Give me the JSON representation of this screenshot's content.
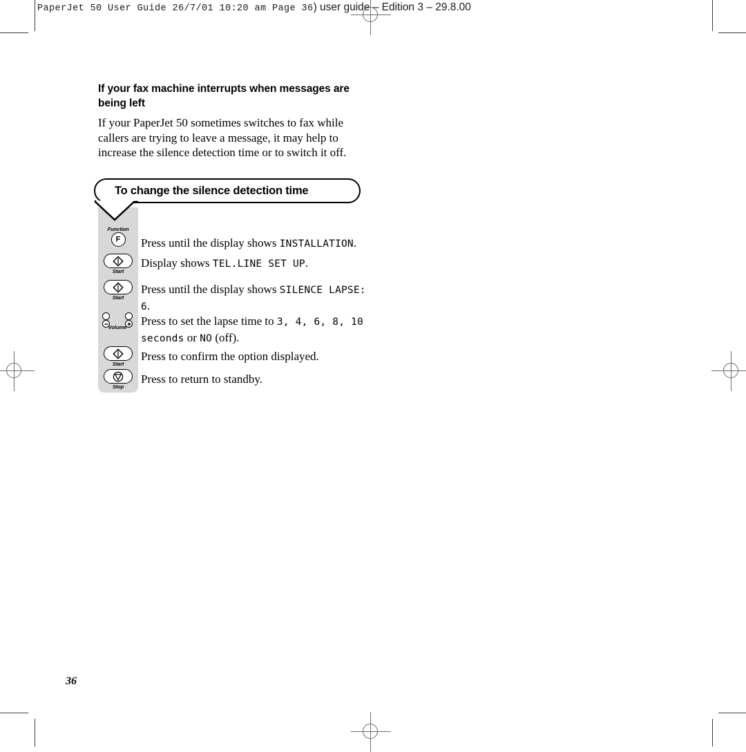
{
  "page": {
    "number": "36",
    "background": "#ffffff",
    "panel_color": "#d8d8d8"
  },
  "header": {
    "mono_text": "PaperJet 50 User Guide  26/7/01  10:20 am  Page 36",
    "sans_text": ") user guide – Edition 3 – 29.8.00"
  },
  "section": {
    "heading": "If your fax machine interrupts when messages are being left",
    "paragraph": "If your PaperJet 50 sometimes switches to fax while callers are trying to leave a message, it may help to increase the silence detection time or to switch it off."
  },
  "callout": {
    "title": "To change the silence detection time"
  },
  "steps": [
    {
      "button": {
        "type": "function",
        "glyph": "F",
        "caption": "Function",
        "caption_position": "above"
      },
      "text_parts": [
        {
          "style": "serif",
          "text": "Press until the display shows "
        },
        {
          "style": "lcd",
          "text": "INSTALLATION"
        },
        {
          "style": "serif",
          "text": "."
        }
      ]
    },
    {
      "button": {
        "type": "start",
        "glyph": "diamond",
        "caption": "Start",
        "caption_position": "below"
      },
      "text_parts": [
        {
          "style": "serif",
          "text": "Display shows "
        },
        {
          "style": "lcd",
          "text": "TEL.LINE SET UP"
        },
        {
          "style": "serif",
          "text": "."
        }
      ]
    },
    {
      "button": {
        "type": "start",
        "glyph": "diamond",
        "caption": "Start",
        "caption_position": "below"
      },
      "text_parts": [
        {
          "style": "serif",
          "text": "Press until the display shows "
        },
        {
          "style": "lcd",
          "text": "SILENCE LAPSE: 6"
        },
        {
          "style": "serif",
          "text": "."
        }
      ]
    },
    {
      "button": {
        "type": "volume",
        "glyph": "minus-plus",
        "caption": "Volume",
        "caption_position": "inline"
      },
      "text_parts": [
        {
          "style": "serif",
          "text": "Press to set the lapse time to "
        },
        {
          "style": "lcd",
          "text": "3, 4, 6, 8, 10 seconds"
        },
        {
          "style": "serif",
          "text": " or "
        },
        {
          "style": "lcd",
          "text": "NO"
        },
        {
          "style": "serif",
          "text": " (off)."
        }
      ]
    },
    {
      "button": {
        "type": "start",
        "glyph": "diamond",
        "caption": "Start",
        "caption_position": "below"
      },
      "text_parts": [
        {
          "style": "serif",
          "text": "Press to confirm the option displayed."
        }
      ]
    },
    {
      "button": {
        "type": "stop",
        "glyph": "triangle-down",
        "caption": "Stop",
        "caption_position": "below"
      },
      "text_parts": [
        {
          "style": "serif",
          "text": "Press to return to standby."
        }
      ]
    }
  ]
}
